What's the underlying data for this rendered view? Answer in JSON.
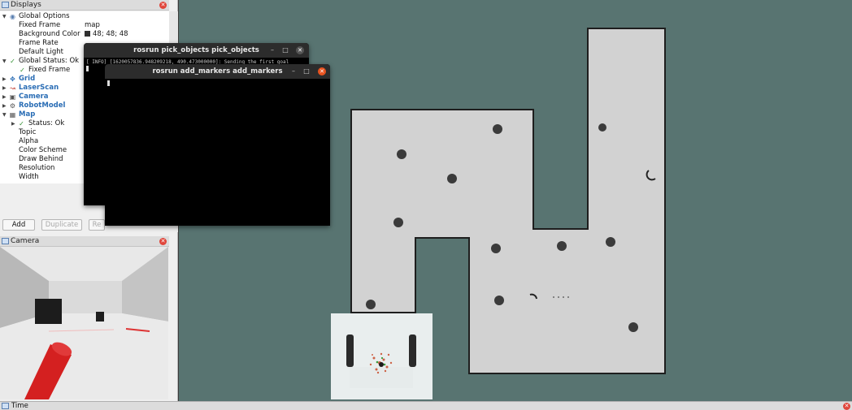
{
  "displays_panel": {
    "title": "Displays",
    "items": [
      {
        "label": "Global Options",
        "value": ""
      },
      {
        "label": "Fixed Frame",
        "value": "map"
      },
      {
        "label": "Background Color",
        "value": "48; 48; 48"
      },
      {
        "label": "Frame Rate",
        "value": ""
      },
      {
        "label": "Default Light",
        "value": ""
      },
      {
        "label": "Global Status: Ok",
        "value": ""
      },
      {
        "label": "Fixed Frame",
        "value": ""
      },
      {
        "label": "Grid",
        "value": ""
      },
      {
        "label": "LaserScan",
        "value": ""
      },
      {
        "label": "Camera",
        "value": ""
      },
      {
        "label": "RobotModel",
        "value": ""
      },
      {
        "label": "Map",
        "value": ""
      },
      {
        "label": "Status: Ok",
        "value": ""
      },
      {
        "label": "Topic",
        "value": ""
      },
      {
        "label": "Alpha",
        "value": ""
      },
      {
        "label": "Color Scheme",
        "value": ""
      },
      {
        "label": "Draw Behind",
        "value": ""
      },
      {
        "label": "Resolution",
        "value": ""
      },
      {
        "label": "Width",
        "value": ""
      }
    ],
    "buttons": {
      "add": "Add",
      "duplicate": "Duplicate",
      "rename": "Re"
    }
  },
  "camera_panel": {
    "title": "Camera"
  },
  "time_panel": {
    "title": "Time"
  },
  "terminals": {
    "pick_objects": {
      "title": "rosrun pick_objects pick_objects",
      "line": "[ INFO] [1620057836.948209218, 490.473000000]: Sending the first goal"
    },
    "add_markers": {
      "title": "rosrun add_markers add_markers"
    }
  },
  "colors": {
    "background": "#303030",
    "map_bg": "#587471",
    "map_floor": "#d2d2d2",
    "accent_blue": "#2a6db5",
    "close_red": "#e0453a"
  }
}
